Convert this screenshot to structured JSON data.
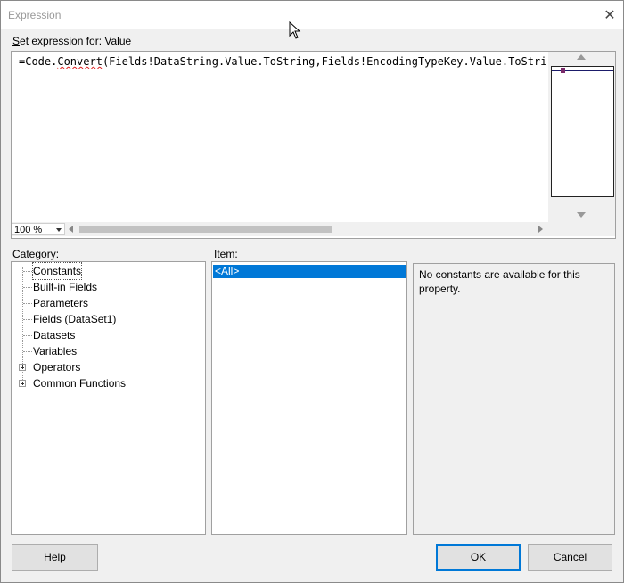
{
  "window": {
    "title": "Expression",
    "close_glyph": "✕"
  },
  "expression": {
    "label_prefix": "S",
    "label_rest": "et expression for: Value",
    "text_prefix": "=Code.",
    "text_squiggle": "Convert",
    "text_rest": "(Fields!DataString.Value.ToString,Fields!EncodingTypeKey.Value.ToString,",
    "zoom": "100 %"
  },
  "category": {
    "label_prefix": "C",
    "label_rest": "ategory:",
    "items": [
      {
        "label": "Constants",
        "expandable": false,
        "selected": true
      },
      {
        "label": "Built-in Fields",
        "expandable": false
      },
      {
        "label": "Parameters",
        "expandable": false
      },
      {
        "label": "Fields (DataSet1)",
        "expandable": false
      },
      {
        "label": "Datasets",
        "expandable": false
      },
      {
        "label": "Variables",
        "expandable": false
      },
      {
        "label": "Operators",
        "expandable": true
      },
      {
        "label": "Common Functions",
        "expandable": true
      }
    ]
  },
  "item": {
    "label_prefix": "I",
    "label_rest": "tem:",
    "selected": "<All>"
  },
  "description": {
    "text": "No constants are available for this property."
  },
  "buttons": {
    "help": "Help",
    "ok": "OK",
    "cancel": "Cancel"
  }
}
